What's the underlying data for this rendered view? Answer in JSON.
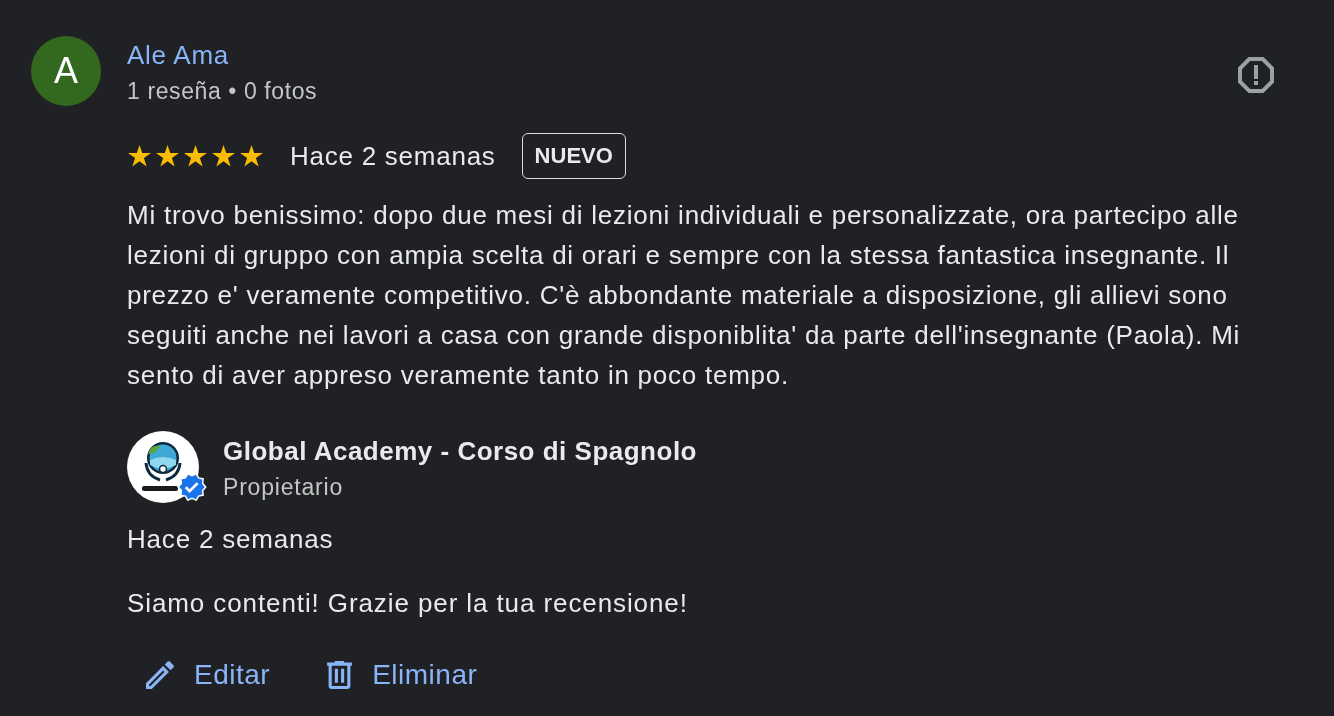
{
  "review": {
    "author": {
      "initial": "A",
      "name": "Ale Ama",
      "stats": "1 reseña • 0 fotos"
    },
    "stars": 5,
    "time": "Hace 2 semanas",
    "badge": "NUEVO",
    "text": "Mi trovo benissimo: dopo due mesi di lezioni individuali e personalizzate, ora partecipo alle lezioni di gruppo con ampia scelta di orari e sempre con la stessa fantastica insegnante. Il prezzo e' veramente competitivo. C'è abbondante materiale a disposizione, gli allievi sono seguiti anche nei lavori a casa con grande disponiblita' da parte dell'insegnante (Paola). Mi sento di aver appreso veramente tanto in poco tempo."
  },
  "owner_reply": {
    "name": "Global Academy - Corso di Spagnolo",
    "role": "Propietario",
    "verified": true,
    "time": "Hace 2 semanas",
    "text": "Siamo contenti! Grazie per la tua recensione!"
  },
  "actions": [
    {
      "kind": "edit",
      "label": "Editar"
    },
    {
      "kind": "delete",
      "label": "Eliminar"
    }
  ]
}
